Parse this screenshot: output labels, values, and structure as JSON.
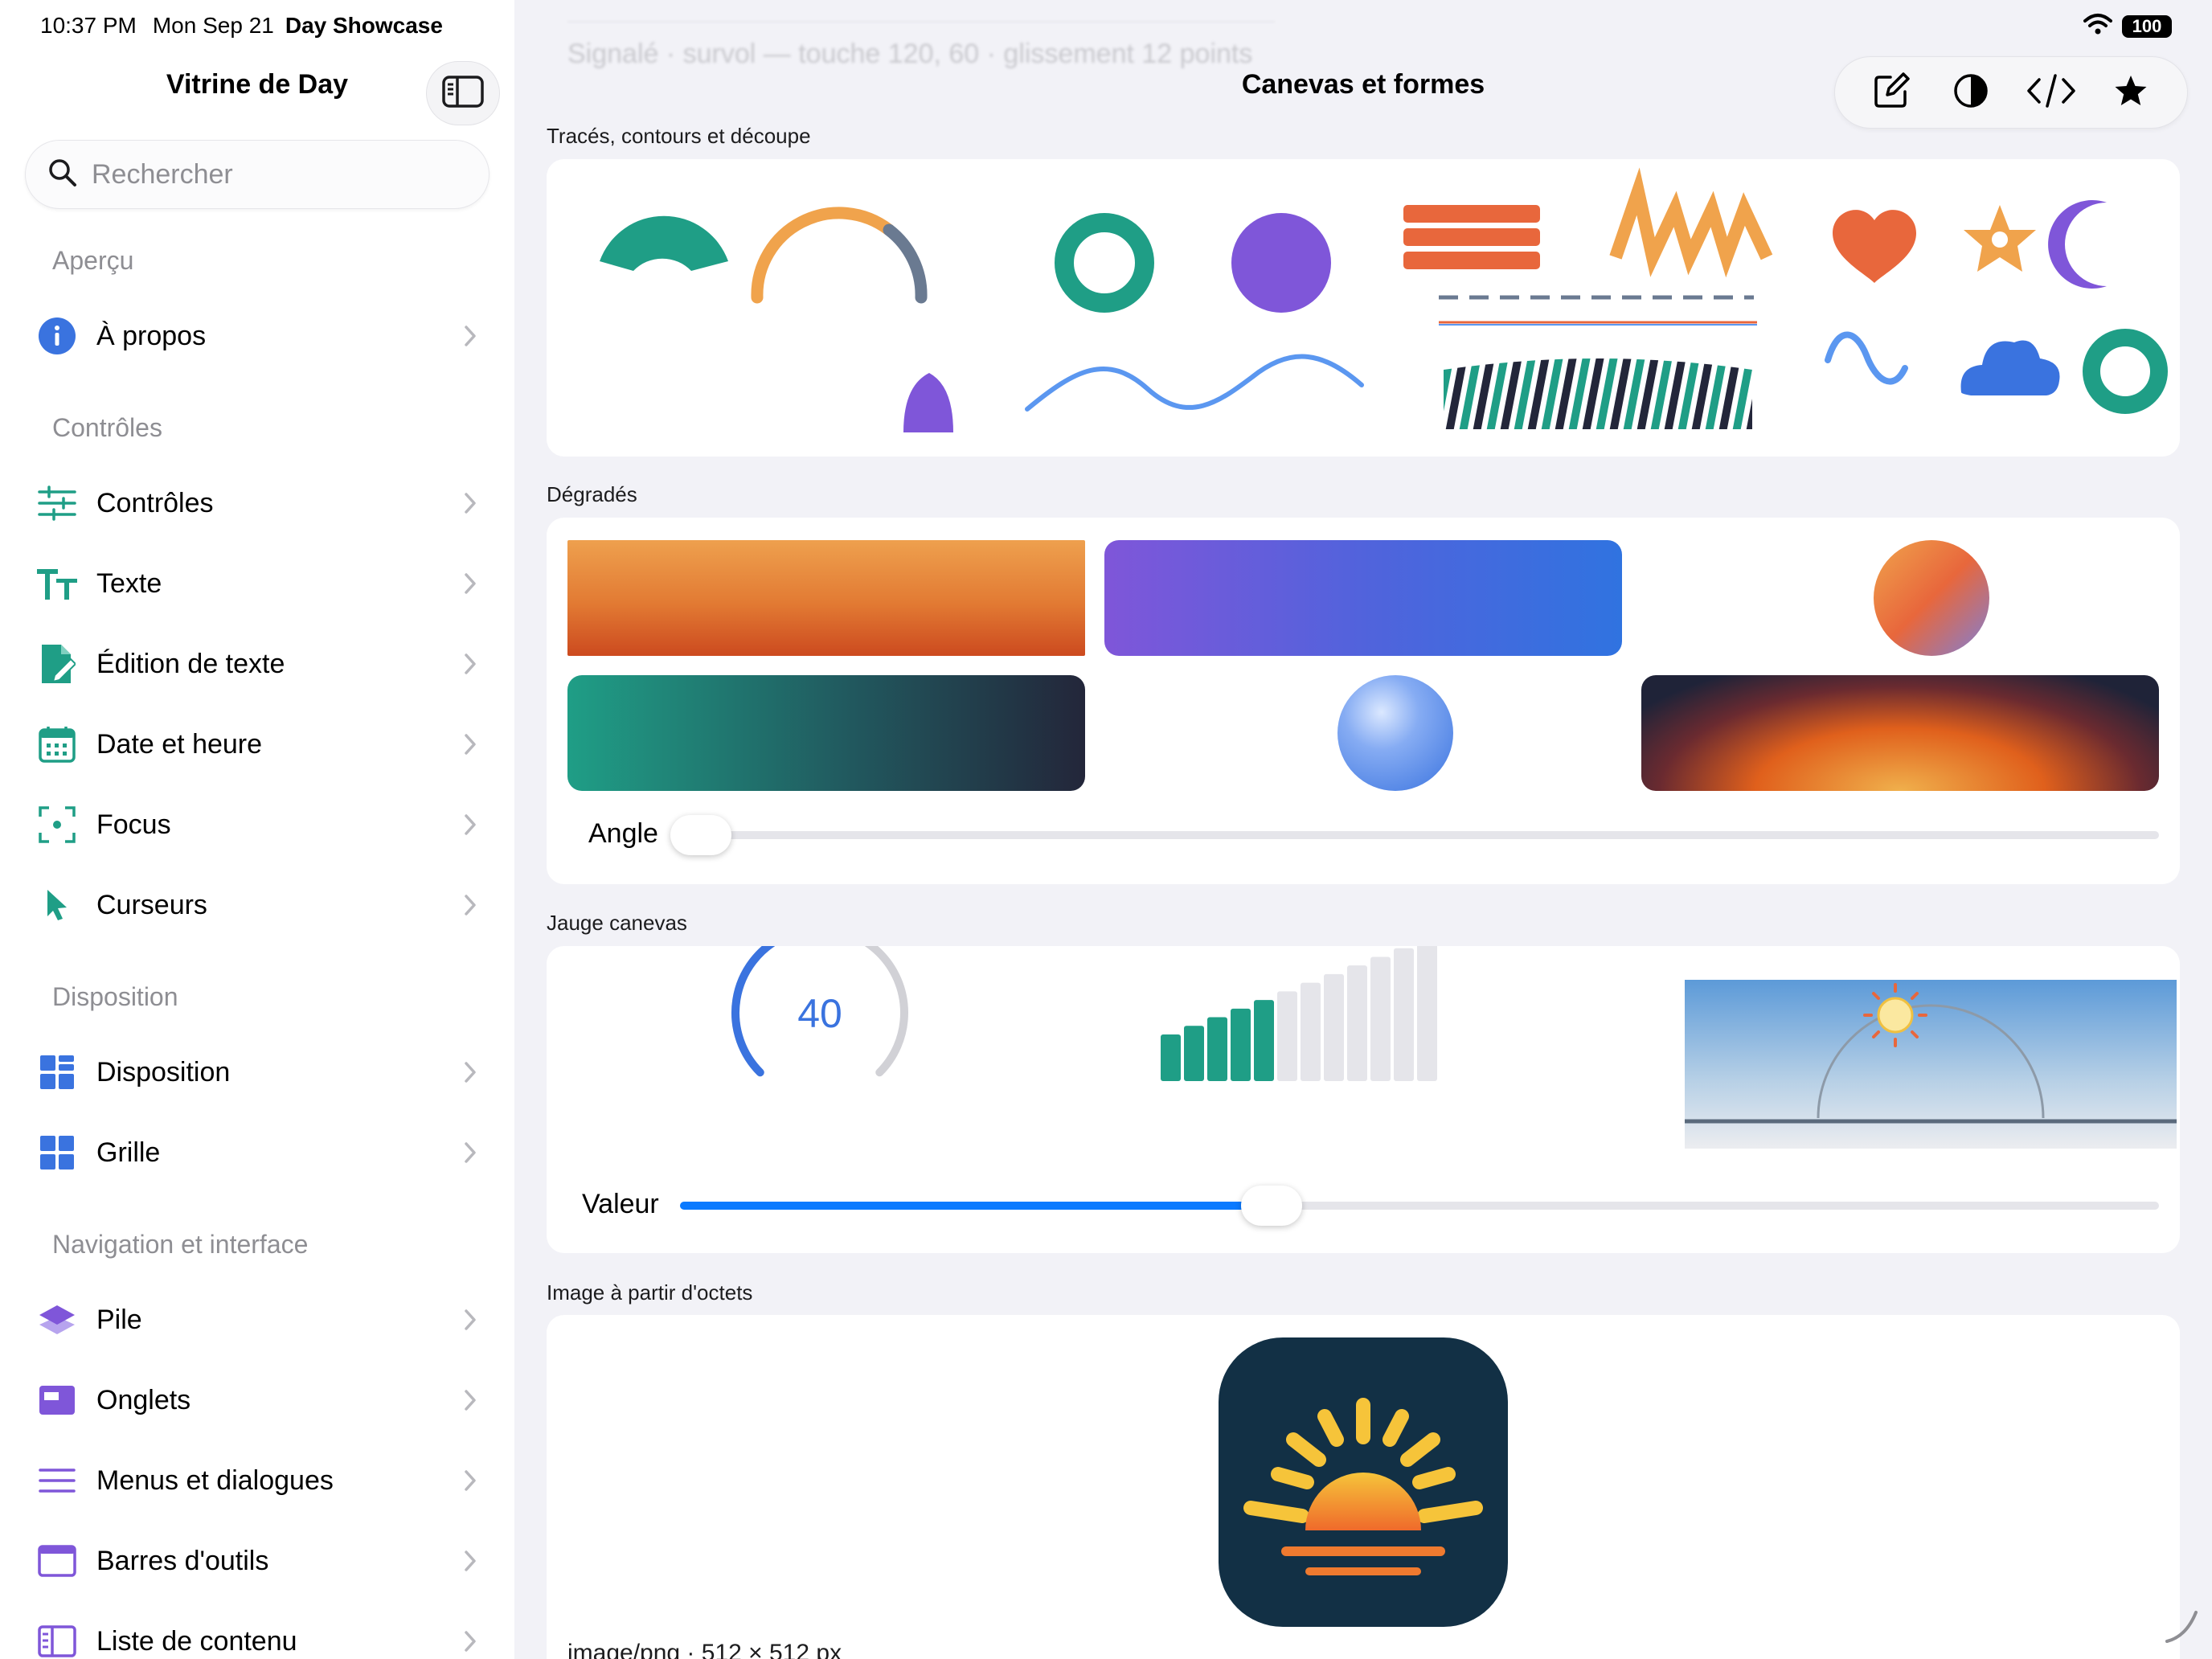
{
  "status": {
    "time": "10:37 PM",
    "date": "Mon Sep 21",
    "app": "Day Showcase",
    "battery": "100"
  },
  "sidebar": {
    "title": "Vitrine de Day",
    "search_placeholder": "Rechercher",
    "sections": [
      {
        "header": "Aperçu",
        "items": [
          {
            "label": "À propos",
            "icon": "info-icon"
          }
        ]
      },
      {
        "header": "Contrôles",
        "items": [
          {
            "label": "Contrôles",
            "icon": "sliders-icon"
          },
          {
            "label": "Texte",
            "icon": "text-size-icon"
          },
          {
            "label": "Édition de texte",
            "icon": "edit-document-icon"
          },
          {
            "label": "Date et heure",
            "icon": "calendar-icon"
          },
          {
            "label": "Focus",
            "icon": "focus-icon"
          },
          {
            "label": "Curseurs",
            "icon": "cursor-icon"
          }
        ]
      },
      {
        "header": "Disposition",
        "items": [
          {
            "label": "Disposition",
            "icon": "layout-icon"
          },
          {
            "label": "Grille",
            "icon": "grid-icon"
          }
        ]
      },
      {
        "header": "Navigation et interface",
        "items": [
          {
            "label": "Pile",
            "icon": "stack-icon"
          },
          {
            "label": "Onglets",
            "icon": "tabs-icon"
          },
          {
            "label": "Menus et dialogues",
            "icon": "menu-icon"
          },
          {
            "label": "Barres d'outils",
            "icon": "toolbar-icon"
          },
          {
            "label": "Liste de contenu",
            "icon": "content-list-icon"
          }
        ]
      }
    ]
  },
  "main": {
    "title": "Canevas et formes",
    "ghost_text": "Signalé · survol — touche 120, 60 · glissement 12 points",
    "sections": {
      "shapes": "Tracés, contours et découpe",
      "gradients": "Dégradés",
      "gauge": "Jauge canevas",
      "image": "Image à partir d'octets"
    },
    "angle_label": "Angle",
    "angle_value": 0,
    "value_label": "Valeur",
    "value": 40,
    "value_max": 100,
    "gauge_value": "40",
    "bars_total": 12,
    "bars_filled": 5,
    "image_caption": "image/png · 512 × 512 px"
  },
  "colors": {
    "accent": "#0a7aff",
    "teal": "#1f9e86",
    "orange": "#e8673c",
    "purple": "#7f56d9",
    "blue": "#3a73df"
  }
}
